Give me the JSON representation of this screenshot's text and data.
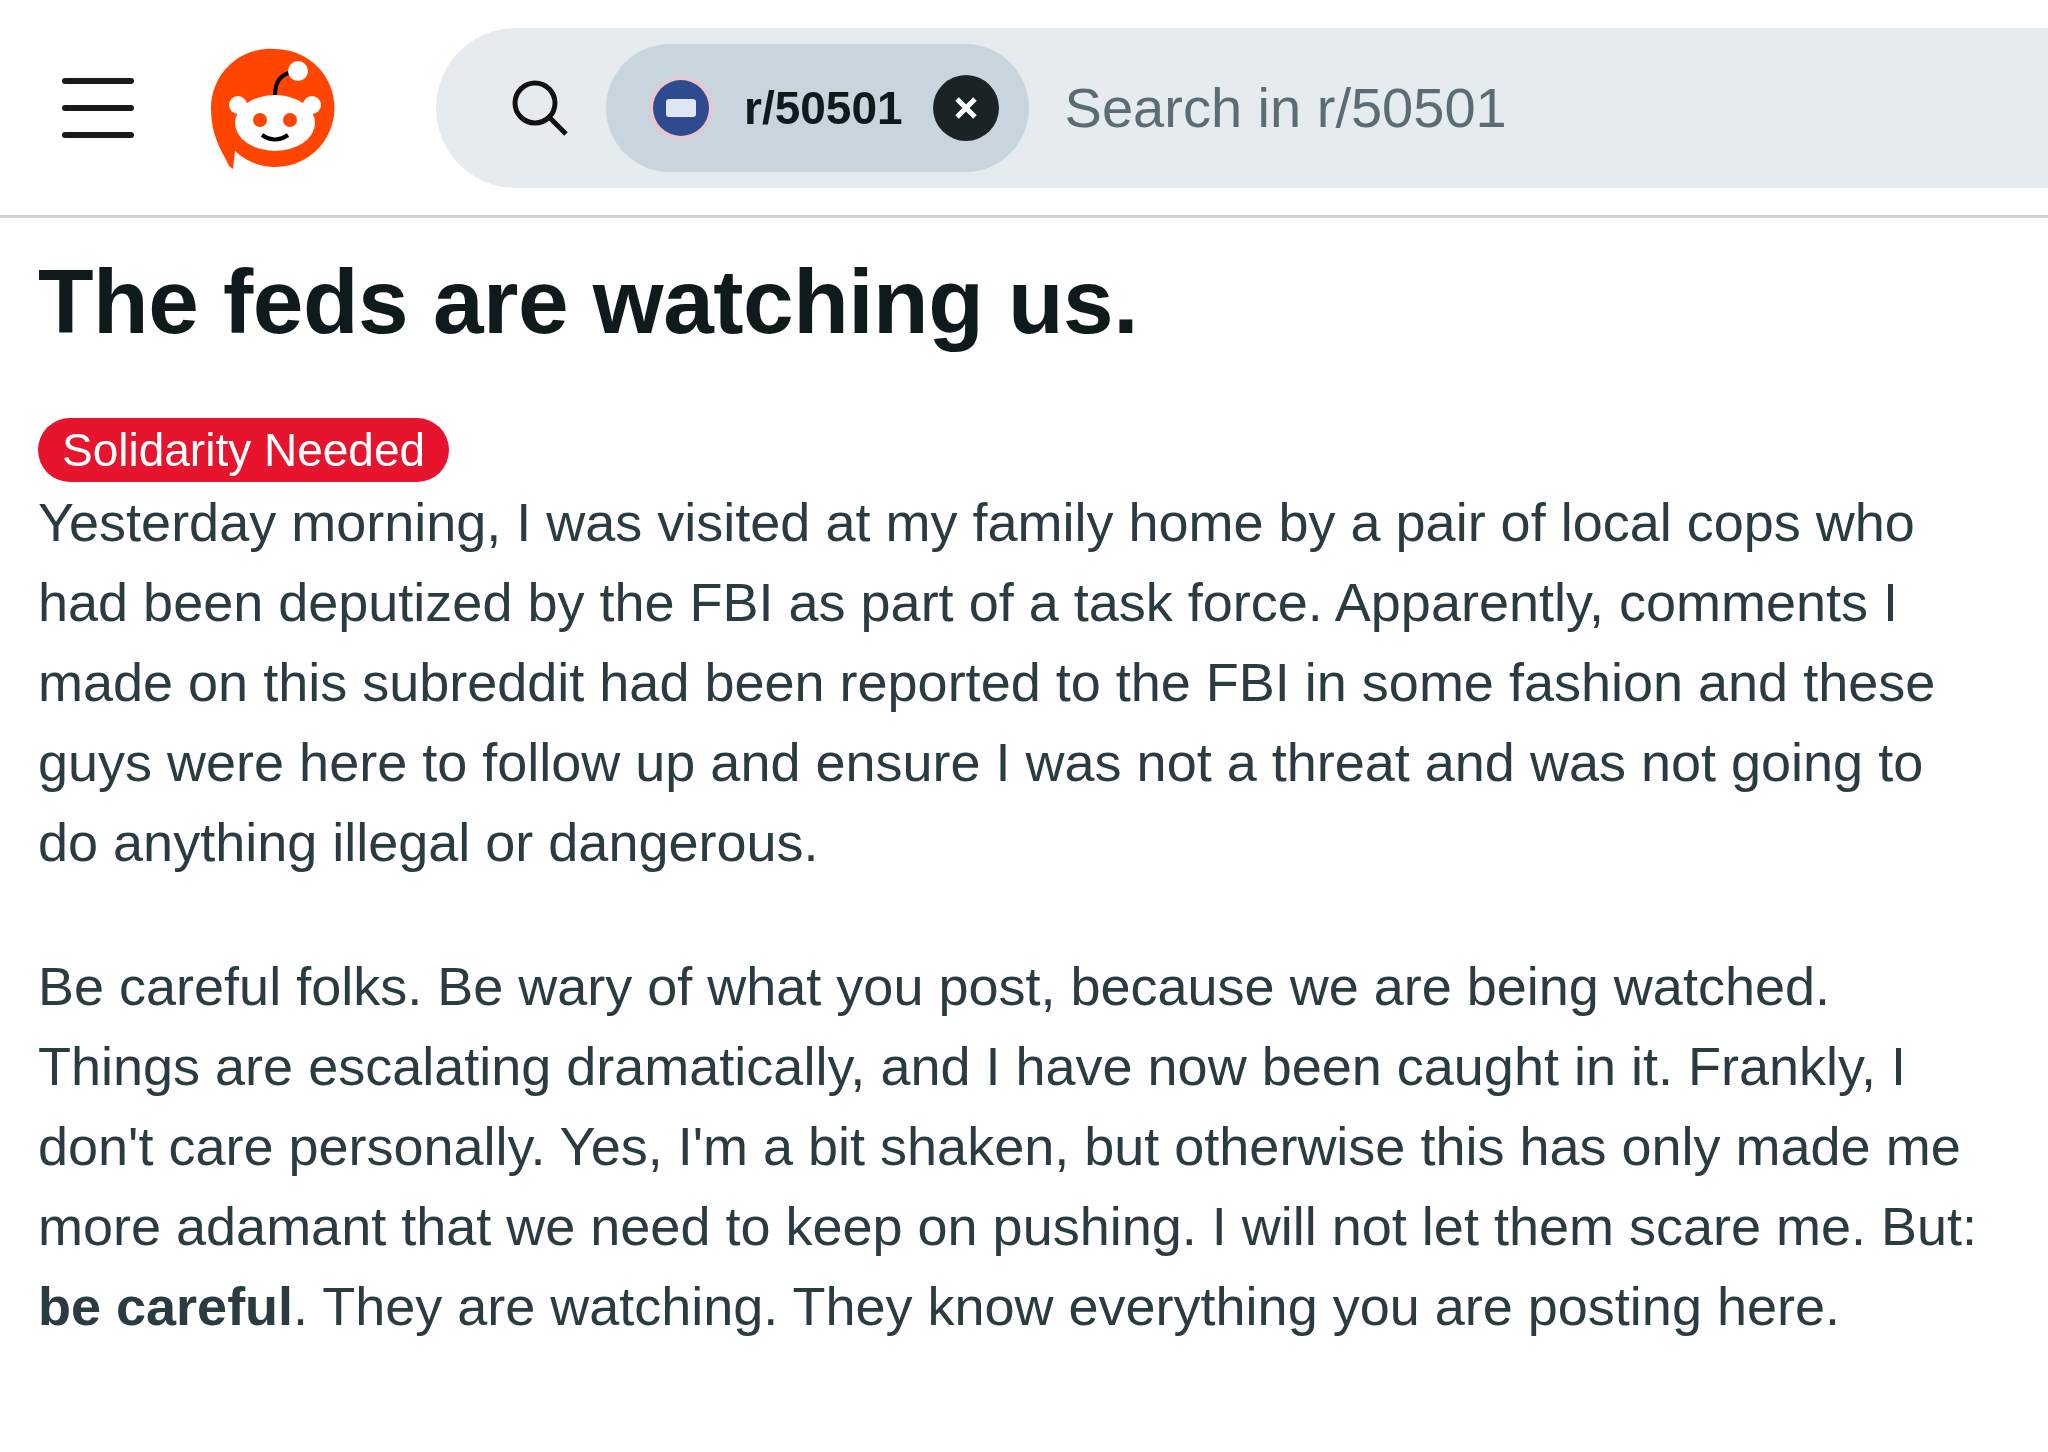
{
  "header": {
    "search": {
      "community": "r/50501",
      "placeholder": "Search in r/50501"
    }
  },
  "post": {
    "title": "The feds are watching us.",
    "flair": {
      "label": "Solidarity Needed",
      "color": "#e6142d"
    },
    "paragraphs": [
      "Yesterday morning, I was visited at my family home by a pair of local cops who had been deputized by the FBI as part of a task force. Apparently, comments I made on this subreddit had been reported to the FBI in some fashion and these guys were here to follow up and ensure I was not a threat and was not going to do anything illegal or dangerous.",
      "Be careful folks. Be wary of what you post, because we are being watched. Things are escalating dramatically, and I have now been caught in it. Frankly, I don't care personally. Yes, I'm a bit shaken, but otherwise this has only made me more adamant that we need to keep on pushing. I will not let them scare me. But: **be careful**. They are watching. They know everything you are posting here."
    ]
  }
}
